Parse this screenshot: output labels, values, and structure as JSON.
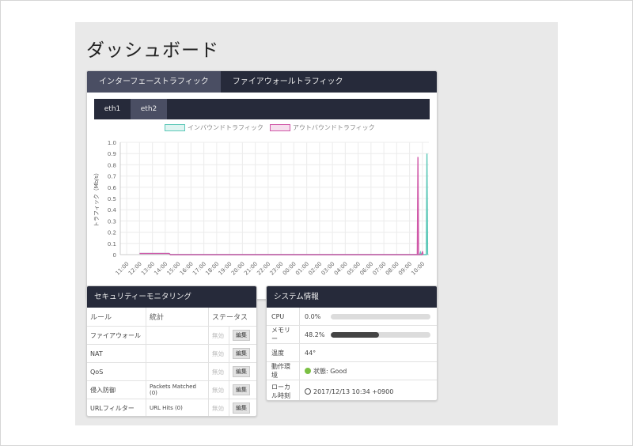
{
  "page": {
    "title": "ダッシュボード"
  },
  "traffic": {
    "tabs": [
      "インターフェーストラフィック",
      "ファイアウォールトラフィック"
    ],
    "subtabs": [
      "eth1",
      "eth2"
    ],
    "legend": [
      {
        "label": "インバウンドトラフィック",
        "color": "#5cc8b8"
      },
      {
        "label": "アウトバウンドトラフィック",
        "color": "#d058a8"
      }
    ]
  },
  "chart_data": {
    "type": "line",
    "ylabel": "トラフィック（Mb/s）",
    "ylim": [
      0,
      1.0
    ],
    "yticks": [
      "0",
      "0.1",
      "0.2",
      "0.3",
      "0.4",
      "0.5",
      "0.6",
      "0.7",
      "0.8",
      "0.9",
      "1.0"
    ],
    "categories": [
      "11:00",
      "12:00",
      "13:00",
      "14:00",
      "15:00",
      "16:00",
      "17:00",
      "18:00",
      "19:00",
      "20:00",
      "21:00",
      "22:00",
      "23:00",
      "00:00",
      "01:00",
      "02:00",
      "03:00",
      "04:00",
      "05:00",
      "06:00",
      "07:00",
      "08:00",
      "09:00",
      "10:00"
    ],
    "series": [
      {
        "name": "インバウンドトラフィック",
        "color": "#5cc8b8",
        "points": [
          [
            1.0,
            0.01
          ],
          [
            3.3,
            0.01
          ],
          [
            3.4,
            0
          ],
          [
            22.8,
            0
          ],
          [
            22.85,
            0.02
          ],
          [
            22.9,
            0
          ],
          [
            23.3,
            0
          ],
          [
            23.35,
            0.9
          ],
          [
            23.4,
            0
          ]
        ]
      },
      {
        "name": "アウトバウンドトラフィック",
        "color": "#d058a8",
        "points": [
          [
            1.0,
            0.01
          ],
          [
            3.3,
            0.01
          ],
          [
            3.4,
            0
          ],
          [
            22.6,
            0
          ],
          [
            22.65,
            0.87
          ],
          [
            22.7,
            0
          ],
          [
            22.95,
            0
          ],
          [
            23.0,
            0.03
          ],
          [
            23.05,
            0
          ]
        ]
      }
    ]
  },
  "security": {
    "title": "セキュリティーモニタリング",
    "headers": [
      "ルール",
      "統計",
      "ステータス"
    ],
    "rows": [
      {
        "rule": "ファイアウォール",
        "stat": "",
        "status": "無効",
        "edit": "編集"
      },
      {
        "rule": "NAT",
        "stat": "",
        "status": "無効",
        "edit": "編集"
      },
      {
        "rule": "QoS",
        "stat": "",
        "status": "無効",
        "edit": "編集"
      },
      {
        "rule": "侵入防御",
        "stat": "Packets Matched (0)",
        "status": "無効",
        "edit": "編集"
      },
      {
        "rule": "URLフィルター",
        "stat": "URL Hits (0)",
        "status": "無効",
        "edit": "編集"
      }
    ]
  },
  "system": {
    "title": "システム情報",
    "cpu": {
      "label": "CPU",
      "value": "0.0%",
      "fraction": 0.0
    },
    "memory": {
      "label": "メモリー",
      "value": "48.2%",
      "fraction": 0.482
    },
    "temp": {
      "label": "温度",
      "value": "44°"
    },
    "status": {
      "label": "動作環境",
      "value": "状態: Good",
      "color": "#7bc043"
    },
    "time": {
      "label": "ローカル時刻",
      "value": "2017/12/13 10:34 +0900"
    }
  }
}
